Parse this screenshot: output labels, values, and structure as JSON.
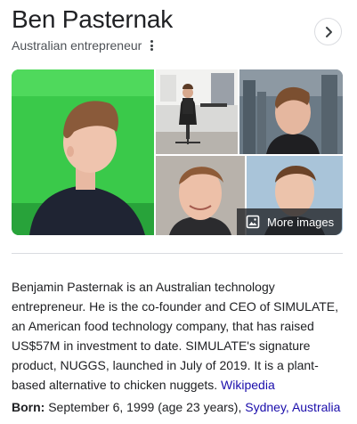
{
  "entity": {
    "name": "Ben Pasternak",
    "subtitle": "Australian entrepreneur"
  },
  "gallery": {
    "more_images_label": "More images",
    "icon": "image-icon"
  },
  "description": {
    "text": "Benjamin Pasternak is an Australian technology entrepreneur. He is the co-founder and CEO of SIMULATE, an American food technology company, that has raised US$57M in investment to date. SIMULATE's signature product, NUGGS, launched in July of 2019. It is a plant-based alternative to chicken nuggets.",
    "source_link": "Wikipedia"
  },
  "facts": {
    "born": {
      "label": "Born:",
      "value": "September 6, 1999 (age 23 years),",
      "place_city": "Sydney",
      "place_sep": ", ",
      "place_country": "Australia"
    }
  },
  "colors": {
    "link": "#1a0dab",
    "text": "#202124",
    "secondary_text": "#4d5156",
    "divider": "#dadce0"
  }
}
